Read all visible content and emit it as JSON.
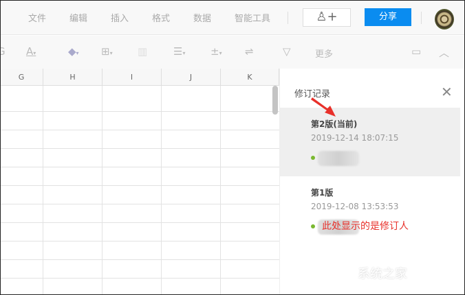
{
  "menu": [
    "文件",
    "编辑",
    "插入",
    "格式",
    "数据",
    "智能工具"
  ],
  "share_label": "分享",
  "toolbar": {
    "more_label": "更多"
  },
  "columns": [
    "G",
    "H",
    "I",
    "J",
    "K"
  ],
  "panel": {
    "title": "修订记录",
    "versions": [
      {
        "name": "第2版(当前)",
        "time": "2019-12-14 18:07:15"
      },
      {
        "name": "第1版",
        "time": "2019-12-08 13:53:53"
      }
    ],
    "annotation": "此处显示的是修订人"
  },
  "watermark": "系统之家",
  "colors": {
    "accent": "#0a8cf0",
    "annotation": "#e8302a",
    "online": "#7ab830"
  }
}
